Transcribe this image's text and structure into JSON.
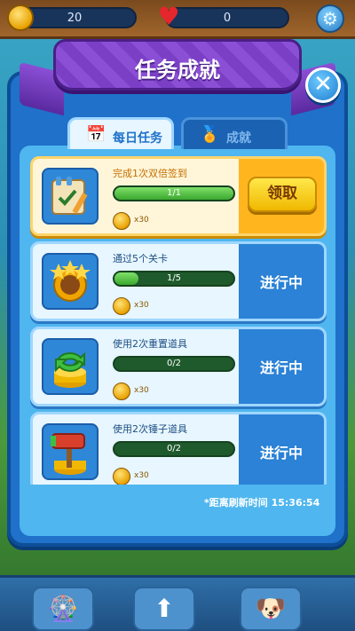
{
  "topbar": {
    "coins": "20",
    "lives": "0",
    "coin_icon": "gold-coin-icon",
    "heart_icon": "heart-icon",
    "settings_icon": "gear-icon"
  },
  "panel": {
    "title": "任务成就",
    "close_label": "✕"
  },
  "tabs": [
    {
      "label": "每日任务",
      "icon": "calendar-icon",
      "active": true
    },
    {
      "label": "成就",
      "icon": "medal-icon",
      "active": false
    }
  ],
  "tasks": [
    {
      "title": "完成1次双倍签到",
      "progress_text": "1/1",
      "progress": 1.0,
      "reward": "x30",
      "state": "领取",
      "done": true,
      "icon": "notebook-icon"
    },
    {
      "title": "通过5个关卡",
      "progress_text": "1/5",
      "progress": 0.2,
      "reward": "x30",
      "state": "进行中",
      "done": false,
      "icon": "level-badge-icon"
    },
    {
      "title": "使用2次重置道具",
      "progress_text": "0/2",
      "progress": 0.0,
      "reward": "x30",
      "state": "进行中",
      "done": false,
      "icon": "reset-arrows-icon"
    },
    {
      "title": "使用2次锤子道具",
      "progress_text": "0/2",
      "progress": 0.0,
      "reward": "x30",
      "state": "进行中",
      "done": false,
      "icon": "hammer-icon"
    }
  ],
  "refresh_text": "*距离刷新时间 15:36:54",
  "colors": {
    "panel": "#1f71c9",
    "banner": "#8b4fd6",
    "claim": "#ffd23a",
    "progress": "#3aa82e"
  }
}
